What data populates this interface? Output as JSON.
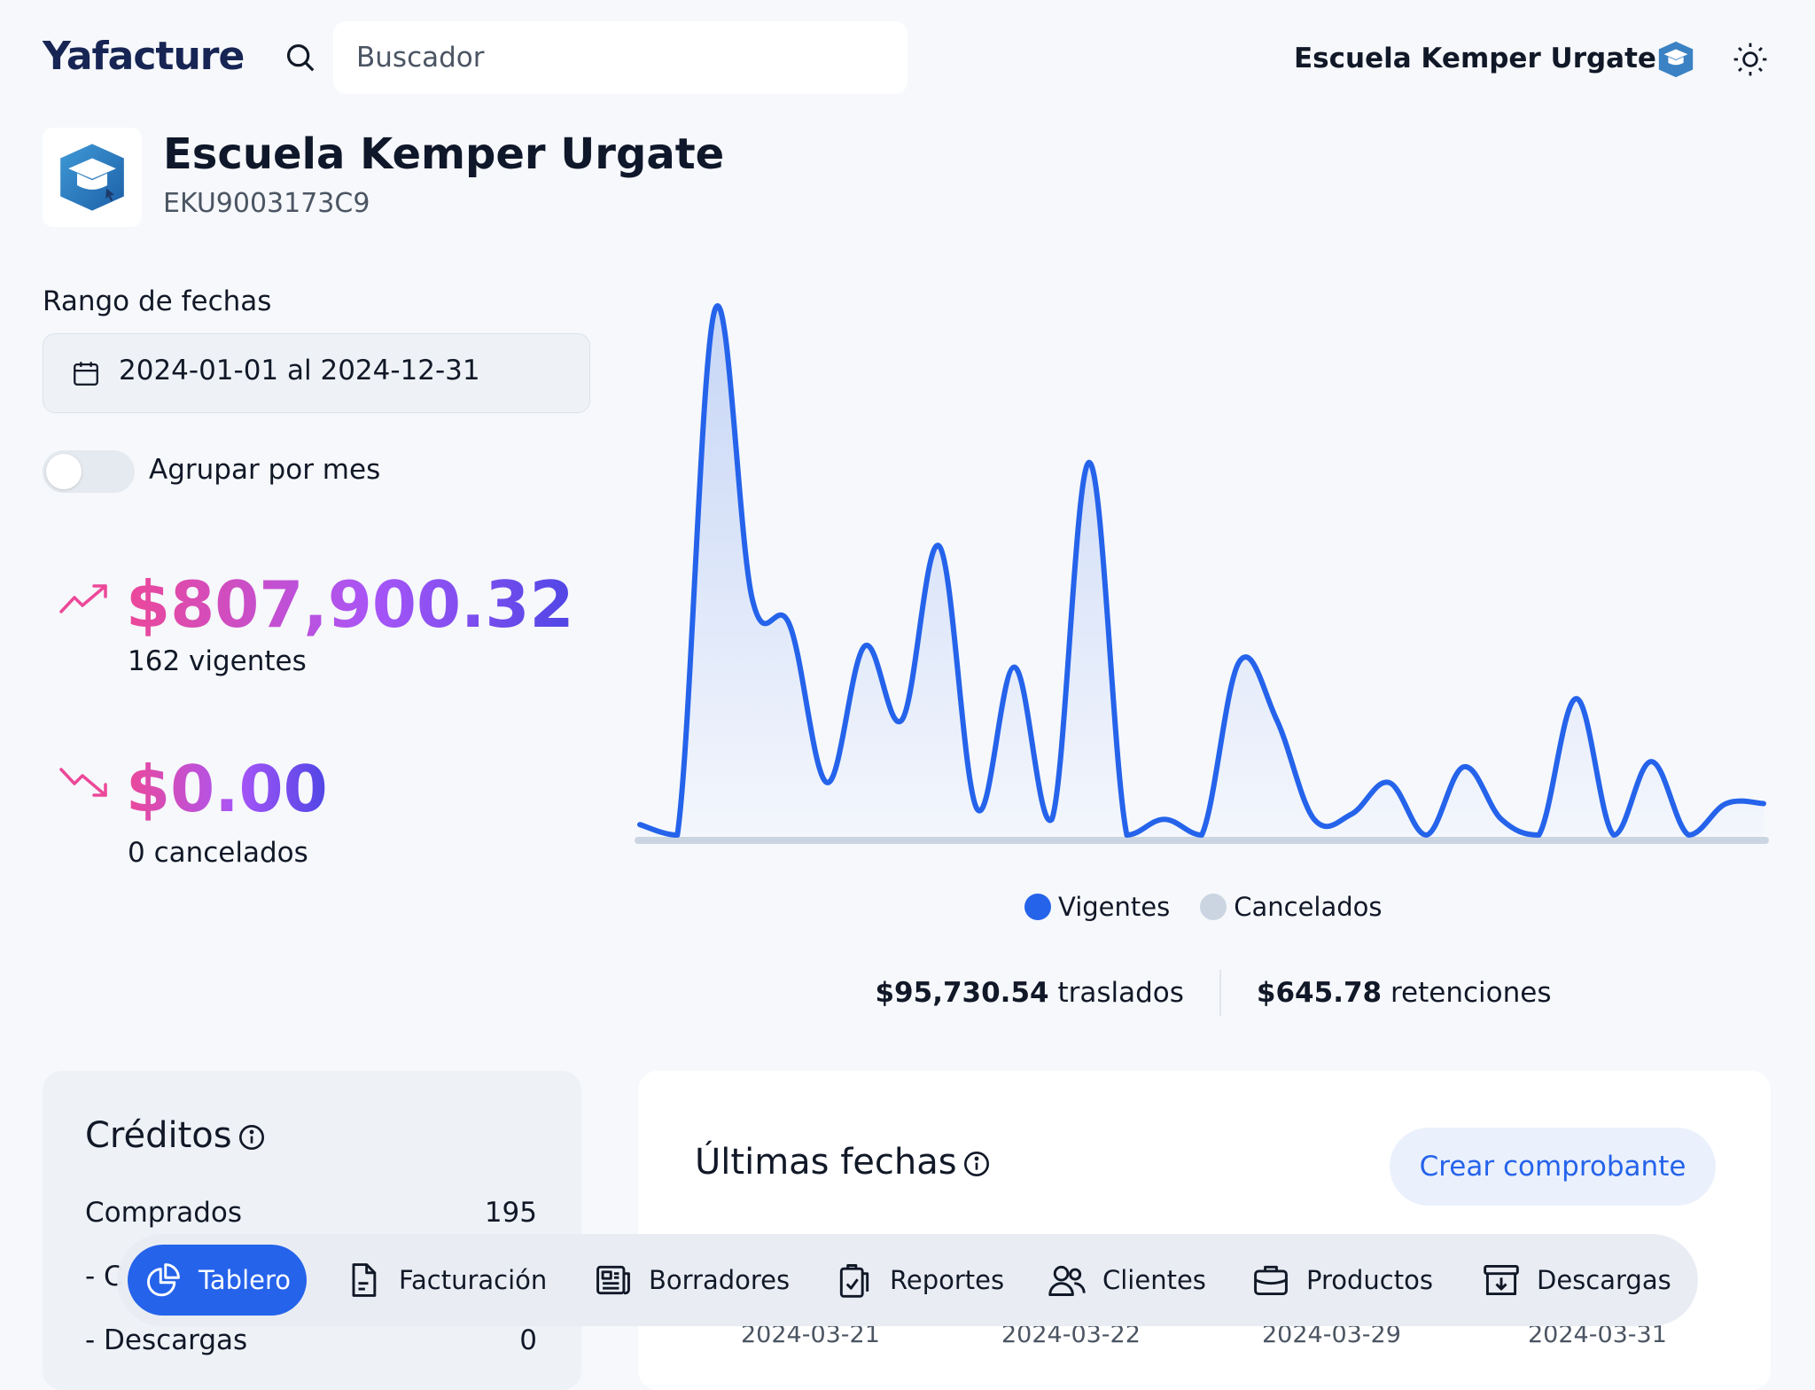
{
  "header": {
    "logo": "Yafacture",
    "search_placeholder": "Buscador",
    "company_name": "Escuela Kemper Urgate"
  },
  "company": {
    "name": "Escuela Kemper Urgate",
    "rfc": "EKU9003173C9"
  },
  "filters": {
    "range_label": "Rango de fechas",
    "range_value": "2024-01-01 al 2024-12-31",
    "group_label": "Agrupar por mes",
    "group_enabled": false
  },
  "summary": {
    "valid_amount": "$807,900.32",
    "valid_count": "162 vigentes",
    "cancel_amount": "$0.00",
    "cancel_count": "0 cancelados"
  },
  "chart_data": {
    "type": "area",
    "series": [
      {
        "name": "Vigentes",
        "color": "#2563eb",
        "values": [
          2,
          0,
          100,
          45,
          40,
          10,
          36,
          22,
          55,
          5,
          32,
          3,
          71,
          0,
          3,
          0,
          33,
          22,
          3,
          4,
          10,
          0,
          13,
          3,
          0,
          26,
          0,
          14,
          0,
          6,
          6
        ]
      },
      {
        "name": "Cancelados",
        "color": "#cbd5e1",
        "values": [
          0,
          0,
          0,
          0,
          0,
          0,
          0,
          0,
          0,
          0,
          0,
          0,
          0,
          0,
          0,
          0,
          0,
          0,
          0,
          0,
          0,
          0,
          0,
          0,
          0,
          0,
          0,
          0,
          0,
          0,
          0
        ]
      }
    ],
    "ylim": [
      0,
      100
    ],
    "grid": false,
    "legend": "bottom-center"
  },
  "legend": {
    "vigentes": "Vigentes",
    "cancelados": "Cancelados"
  },
  "taxes": {
    "traslados_amount": "$95,730.54",
    "traslados_label": "traslados",
    "retenciones_amount": "$645.78",
    "retenciones_label": "retenciones"
  },
  "credits": {
    "title": "Créditos",
    "rows": [
      {
        "label": "Comprados",
        "value": "195"
      },
      {
        "label": "- C",
        "value": ""
      },
      {
        "label": "- Descargas",
        "value": "0"
      }
    ]
  },
  "dates": {
    "title": "Últimas fechas",
    "create_button": "Crear comprobante",
    "values": [
      "2024-03-21",
      "2024-03-22",
      "2024-03-29",
      "2024-03-31"
    ]
  },
  "nav": {
    "items": [
      {
        "label": "Tablero",
        "icon": "pie-chart-icon",
        "active": true
      },
      {
        "label": "Facturación",
        "icon": "document-icon"
      },
      {
        "label": "Borradores",
        "icon": "newspaper-icon"
      },
      {
        "label": "Reportes",
        "icon": "clipboard-check-icon"
      },
      {
        "label": "Clientes",
        "icon": "users-icon"
      },
      {
        "label": "Productos",
        "icon": "briefcase-icon"
      },
      {
        "label": "Descargas",
        "icon": "archive-download-icon"
      }
    ]
  },
  "colors": {
    "accent": "#2563eb",
    "brand_dark": "#172554",
    "amount_gradient_start": "#ec4899",
    "amount_gradient_end": "#4f46e5"
  }
}
